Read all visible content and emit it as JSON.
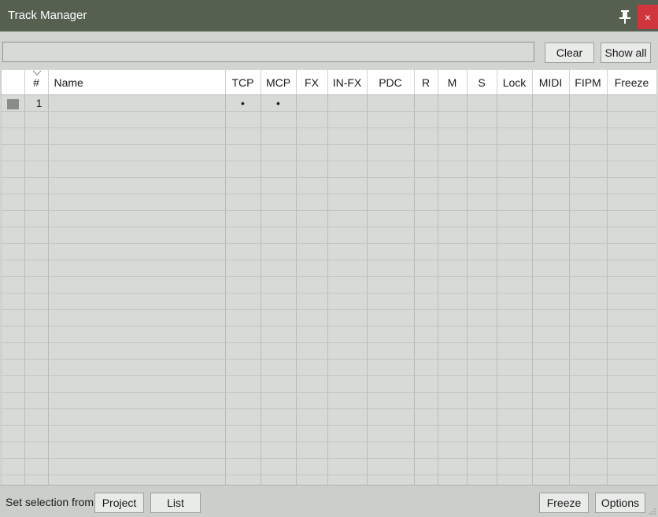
{
  "window": {
    "title": "Track Manager",
    "close_label": "×"
  },
  "toolbar": {
    "search_value": "",
    "clear_label": "Clear",
    "show_all_label": "Show all"
  },
  "table": {
    "columns": [
      "",
      "#",
      "Name",
      "TCP",
      "MCP",
      "FX",
      "IN-FX",
      "PDC",
      "R",
      "M",
      "S",
      "Lock",
      "MIDI",
      "FIPM",
      "Freeze"
    ],
    "rows": [
      {
        "color": "#8a8c8a",
        "num": "1",
        "name": "",
        "tcp": "•",
        "mcp": "•",
        "fx": "",
        "infx": "",
        "pdc": "",
        "r": "",
        "m": "",
        "s": "",
        "lock": "",
        "midi": "",
        "fipm": "",
        "freeze": ""
      }
    ],
    "empty_rows": 23
  },
  "statusbar": {
    "label": "Set selection from:",
    "project_label": "Project",
    "list_label": "List",
    "freeze_label": "Freeze",
    "options_label": "Options"
  },
  "colors": {
    "titlebar": "#556050",
    "close": "#d0343c",
    "grid_bg": "#d8dad8"
  }
}
